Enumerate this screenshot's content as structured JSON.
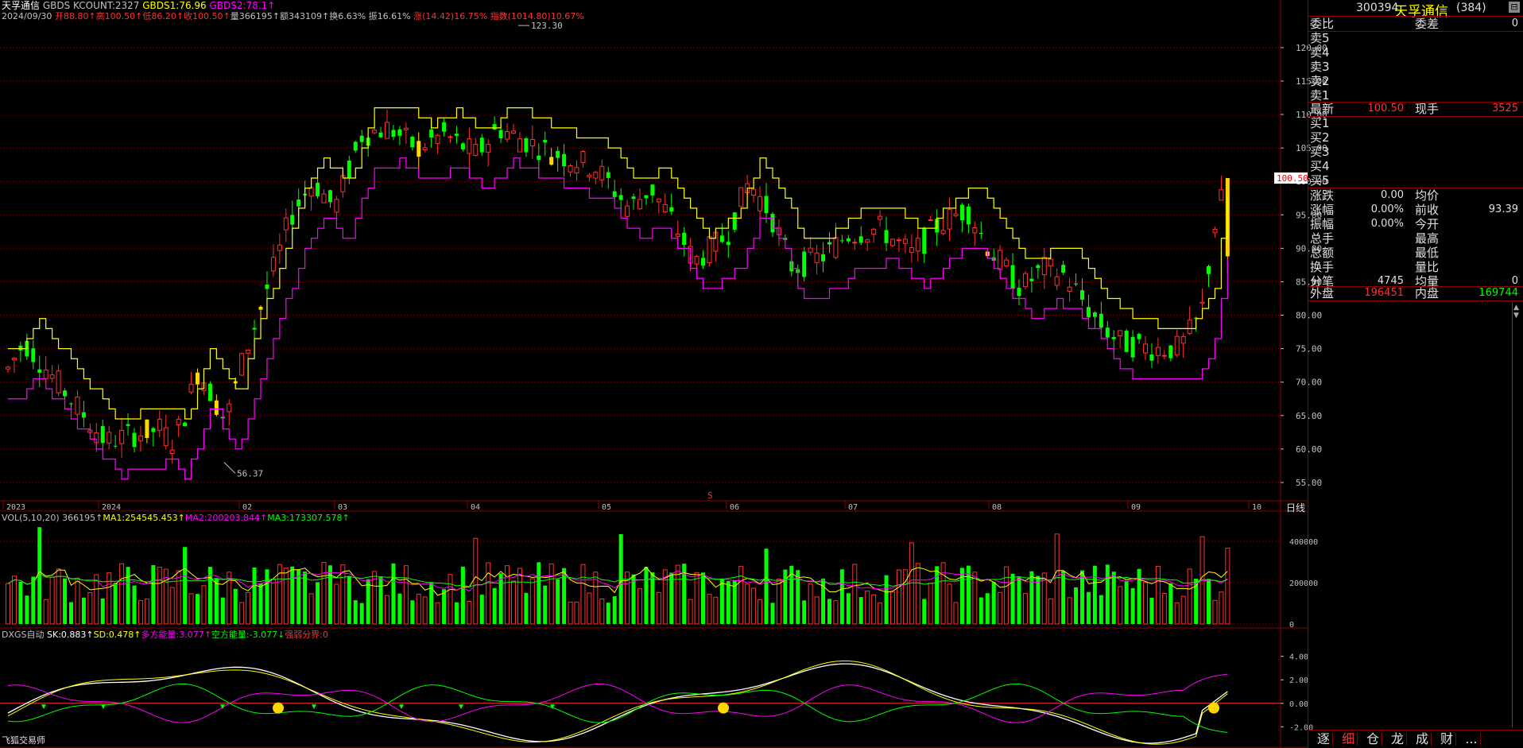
{
  "stock": {
    "name": "天孚通信",
    "code": "300394",
    "count": "(384)"
  },
  "header_line1": [
    {
      "text": "天孚通信",
      "color": "#ffffff"
    },
    {
      "text": " GBDS  KCOUNT:2327 ",
      "color": "#c0c0c0"
    },
    {
      "text": "GBDS1:76.96 ",
      "color": "#ffff00"
    },
    {
      "text": "GBDS2:78.1↑",
      "color": "#ff00ff"
    }
  ],
  "header_line2": [
    {
      "text": "2024/09/30 ",
      "color": "#c0c0c0"
    },
    {
      "text": "开88.80↑",
      "color": "#ff3030"
    },
    {
      "text": "高100.50↑",
      "color": "#ff3030"
    },
    {
      "text": "低86.20↑",
      "color": "#ff3030"
    },
    {
      "text": "收100.50↑",
      "color": "#ff3030"
    },
    {
      "text": "量366195↑",
      "color": "#c0c0c0"
    },
    {
      "text": "额343109↑",
      "color": "#c0c0c0"
    },
    {
      "text": "换6.63% ",
      "color": "#c0c0c0"
    },
    {
      "text": "振16.61% ",
      "color": "#c0c0c0"
    },
    {
      "text": "涨(14.42)16.75% ",
      "color": "#ff3030"
    },
    {
      "text": "指数(1014.80)10.67%",
      "color": "#ff3030"
    }
  ],
  "price_axis": [
    "120.00",
    "115.00",
    "110.00",
    "105.00",
    "100.00",
    "95.00",
    "90.00",
    "85.00",
    "80.00",
    "75.00",
    "70.00",
    "65.00",
    "60.00",
    "55.00"
  ],
  "current_price_tag": "100.50",
  "max_label": "123.30",
  "min_label": "56.37",
  "date_axis": [
    "2023",
    "2024",
    "02",
    "03",
    "04",
    "05",
    "06",
    "07",
    "08",
    "09",
    "10"
  ],
  "period_label": "日线",
  "s_marker": "S",
  "vol_header": [
    {
      "text": "VOL(5,10,20)  366195↑",
      "color": "#c0c0c0"
    },
    {
      "text": "MA1:254545.453↑",
      "color": "#ffff00"
    },
    {
      "text": "MA2:200203.844↑",
      "color": "#ff00ff"
    },
    {
      "text": "MA3:173307.578↑",
      "color": "#00ff00"
    }
  ],
  "vol_axis": [
    "400000",
    "200000",
    "0"
  ],
  "ind_header": [
    {
      "text": "DXGS自动 ",
      "color": "#c0c0c0"
    },
    {
      "text": "SK:0.883↑",
      "color": "#ffffff"
    },
    {
      "text": "SD:0.478↑",
      "color": "#ffff00"
    },
    {
      "text": "多方能量:3.077↑",
      "color": "#ff00ff"
    },
    {
      "text": "空方能量:-3.077↓",
      "color": "#00ff00"
    },
    {
      "text": "强弱分界:0",
      "color": "#ff3030"
    }
  ],
  "ind_axis": [
    "4.00",
    "2.00",
    "0.00",
    "-2.00"
  ],
  "app_name": "飞狐交易师",
  "order_book": {
    "webi_label": "委比",
    "webi_value": "",
    "weicha_label": "委差",
    "weicha_value": "0",
    "sell": [
      "卖5",
      "卖4",
      "卖3",
      "卖2",
      "卖1"
    ],
    "last_label": "最新",
    "last_value": "100.50",
    "hand_label": "现手",
    "hand_value": "3525",
    "buy": [
      "买1",
      "买2",
      "买3",
      "买4",
      "买5"
    ]
  },
  "stats": [
    {
      "l1": "涨跌",
      "v1": "0.00",
      "l2": "均价",
      "v2": ""
    },
    {
      "l1": "涨幅",
      "v1": "0.00%",
      "l2": "前收",
      "v2": "93.39"
    },
    {
      "l1": "振幅",
      "v1": "0.00%",
      "l2": "今开",
      "v2": ""
    },
    {
      "l1": "总手",
      "v1": "",
      "l2": "最高",
      "v2": ""
    },
    {
      "l1": "总额",
      "v1": "",
      "l2": "最低",
      "v2": ""
    },
    {
      "l1": "换手",
      "v1": "",
      "l2": "量比",
      "v2": ""
    },
    {
      "l1": "分笔",
      "v1": "4745",
      "l2": "均量",
      "v2": "0"
    }
  ],
  "outer_label": "外盘",
  "outer_value": "196451",
  "inner_label": "内盘",
  "inner_value": "169744",
  "bottom_tabs": [
    "逐",
    "细",
    "仓",
    "龙",
    "成",
    "财",
    "..."
  ],
  "colors": {
    "up": "#ff3030",
    "down": "#00ff00",
    "grid": "#8b0000",
    "upper_band": "#ffff00",
    "lower_band": "#ff00ff"
  }
}
